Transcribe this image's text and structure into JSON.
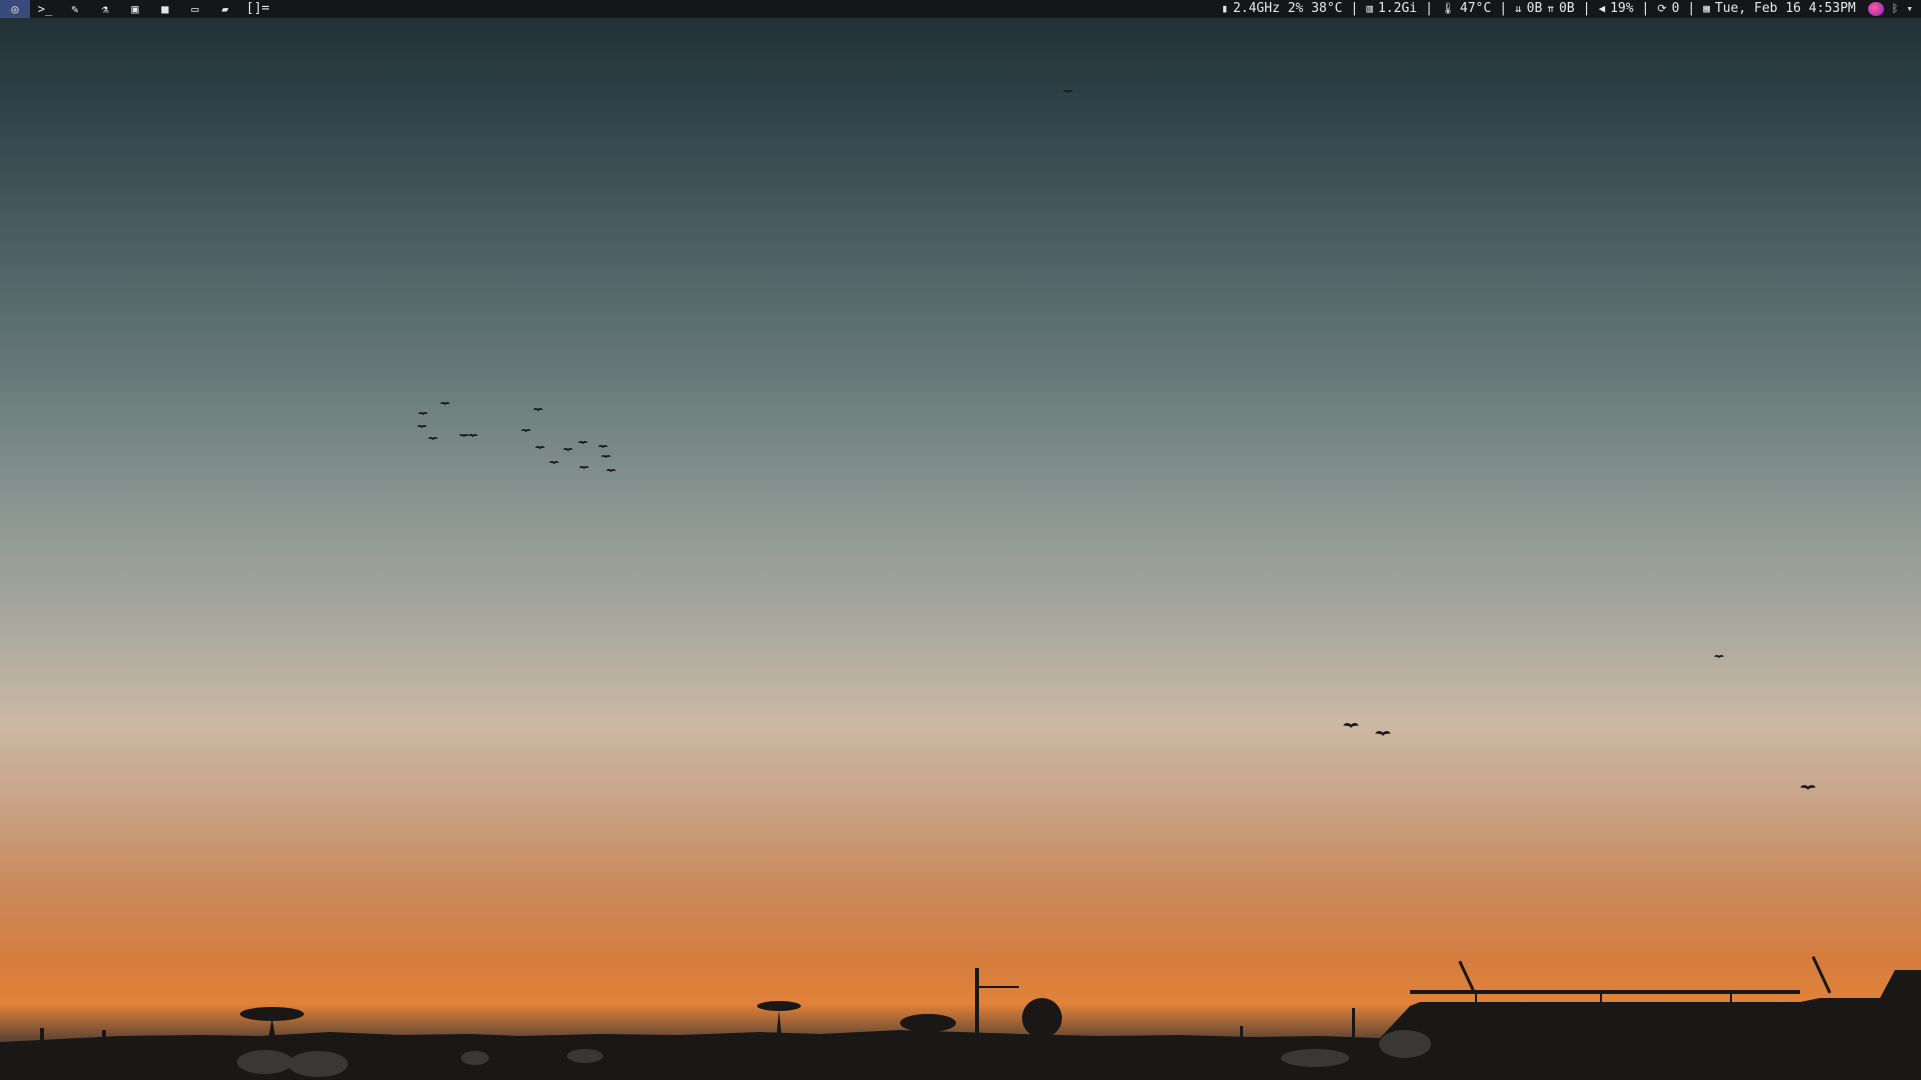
{
  "topbar": {
    "launchers": [
      {
        "name": "globe-icon",
        "glyph": "◎"
      },
      {
        "name": "terminal-icon",
        "glyph": ">_"
      },
      {
        "name": "pen-icon",
        "glyph": "✎"
      },
      {
        "name": "flask-icon",
        "glyph": "⚗"
      },
      {
        "name": "image-icon",
        "glyph": "▣"
      },
      {
        "name": "video-camera-icon",
        "glyph": "■"
      },
      {
        "name": "laptop-icon",
        "glyph": "▭"
      },
      {
        "name": "folder-icon",
        "glyph": "▰"
      }
    ],
    "layout_indicator": "[]=",
    "cpu": {
      "icon": "cpu-icon",
      "glyph": "▮",
      "text": "2.4GHz 2% 38°C"
    },
    "memory": {
      "icon": "memory-icon",
      "glyph": "▥",
      "text": "1.2Gi"
    },
    "temperature": {
      "icon": "thermometer-icon",
      "glyph": "🌡",
      "text": "47°C"
    },
    "network": {
      "down_glyph": "⇊",
      "down": "0B",
      "up_glyph": "⇈",
      "up": "0B"
    },
    "volume": {
      "icon": "speaker-icon",
      "glyph": "◀",
      "text": "19%"
    },
    "updates": {
      "icon": "refresh-icon",
      "glyph": "⟳",
      "text": "0"
    },
    "datetime": {
      "icon": "calendar-icon",
      "glyph": "▦",
      "text": "Tue, Feb 16 4:53PM"
    },
    "separator": "|",
    "tray": {
      "bluetooth_glyph": "ᛒ",
      "wifi_glyph": "▾"
    }
  },
  "colors": {
    "bar_bg": "#14161a",
    "bar_fg": "#e6e6e6",
    "active_launcher": "#3a4a7a"
  }
}
